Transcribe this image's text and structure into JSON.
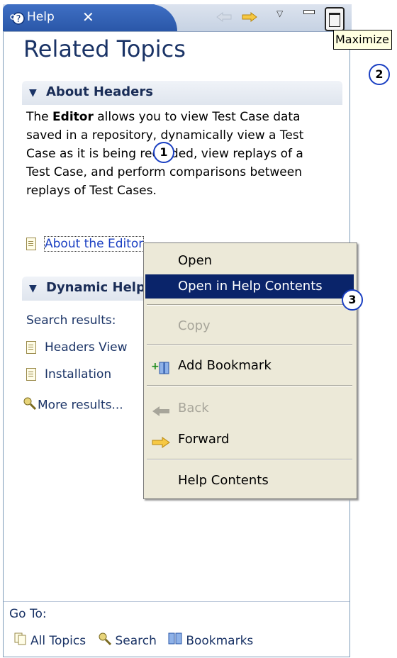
{
  "tab": {
    "label": "Help",
    "close_glyph": "✕",
    "icon": "help-icon"
  },
  "toolbar": {
    "menu_glyph": "▽",
    "back_icon": "back-arrow-icon",
    "forward_icon": "forward-arrow-icon"
  },
  "tooltip": "Maximize",
  "callouts": [
    "1",
    "2",
    "3"
  ],
  "title": "Related Topics",
  "section1": {
    "label": "About Headers"
  },
  "paragraph": {
    "before": "The ",
    "bold": "Editor",
    "after": " allows you to view Test Case data saved in a repository, dynamically view a Test Case as it is being recorded, view replays of a Test Case, and perform comparisons between replays of Test Cases."
  },
  "link_about": "About the Editor",
  "section2": {
    "label": "Dynamic Help"
  },
  "search_label": "Search results:",
  "results": [
    "Headers View",
    "Installation"
  ],
  "more_results": "More results...",
  "menu": {
    "open": "Open",
    "open_in_help": "Open in Help Contents",
    "copy": "Copy",
    "add_bookmark": "Add Bookmark",
    "back": "Back",
    "forward": "Forward",
    "help_contents": "Help Contents"
  },
  "footer": {
    "goto": "Go To:",
    "all_topics": "All Topics",
    "search": "Search",
    "bookmarks": "Bookmarks"
  },
  "colors": {
    "accent": "#1a3366",
    "selection": "#0a246a",
    "link": "#1a3fc2",
    "menu_bg": "#ece9d8"
  }
}
